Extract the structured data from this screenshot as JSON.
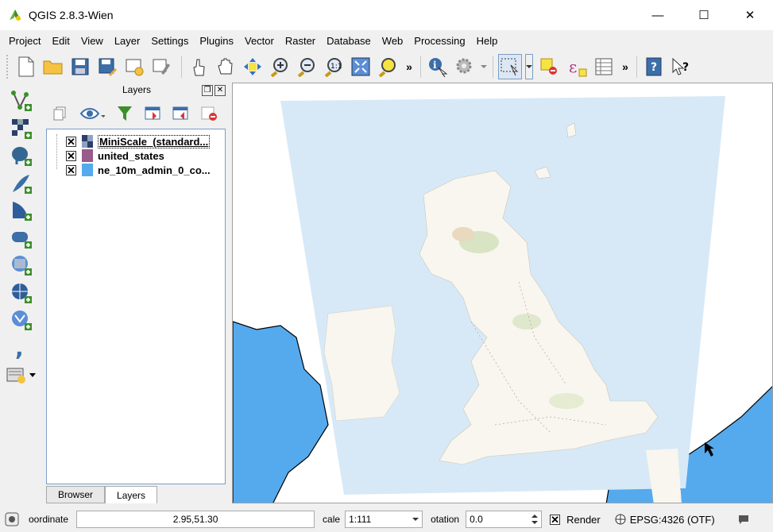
{
  "window": {
    "title": "QGIS 2.8.3-Wien",
    "minimize": "—",
    "maximize": "☐",
    "close": "✕"
  },
  "menu": [
    "Project",
    "Edit",
    "View",
    "Layer",
    "Settings",
    "Plugins",
    "Vector",
    "Raster",
    "Database",
    "Web",
    "Processing",
    "Help"
  ],
  "toolbar": {
    "more1": "»",
    "more2": "»"
  },
  "panel": {
    "title": "Layers",
    "float_label": "❐",
    "close_label": "✕",
    "layers": [
      {
        "name": "MiniScale_(standard...",
        "checked": "✕",
        "color": "#2c3e6b"
      },
      {
        "name": "united_states",
        "checked": "✕",
        "color": "#9a5a8a"
      },
      {
        "name": "ne_10m_admin_0_co...",
        "checked": "✕",
        "color": "#55aaee"
      }
    ],
    "tabs": [
      "Browser",
      "Layers"
    ]
  },
  "status": {
    "coordinate_label": "oordinate",
    "coordinate_value": "2.95,51.30",
    "scale_label": "cale",
    "scale_value": "1:111",
    "rotation_label": "otation",
    "rotation_value": "0.0",
    "render_check": "✕",
    "render_label": "Render",
    "crs_label": "EPSG:4326 (OTF)"
  },
  "colors": {
    "sea": "#55aaee",
    "raster_sea": "#d7e9f7",
    "land": "#f8f6ee"
  }
}
